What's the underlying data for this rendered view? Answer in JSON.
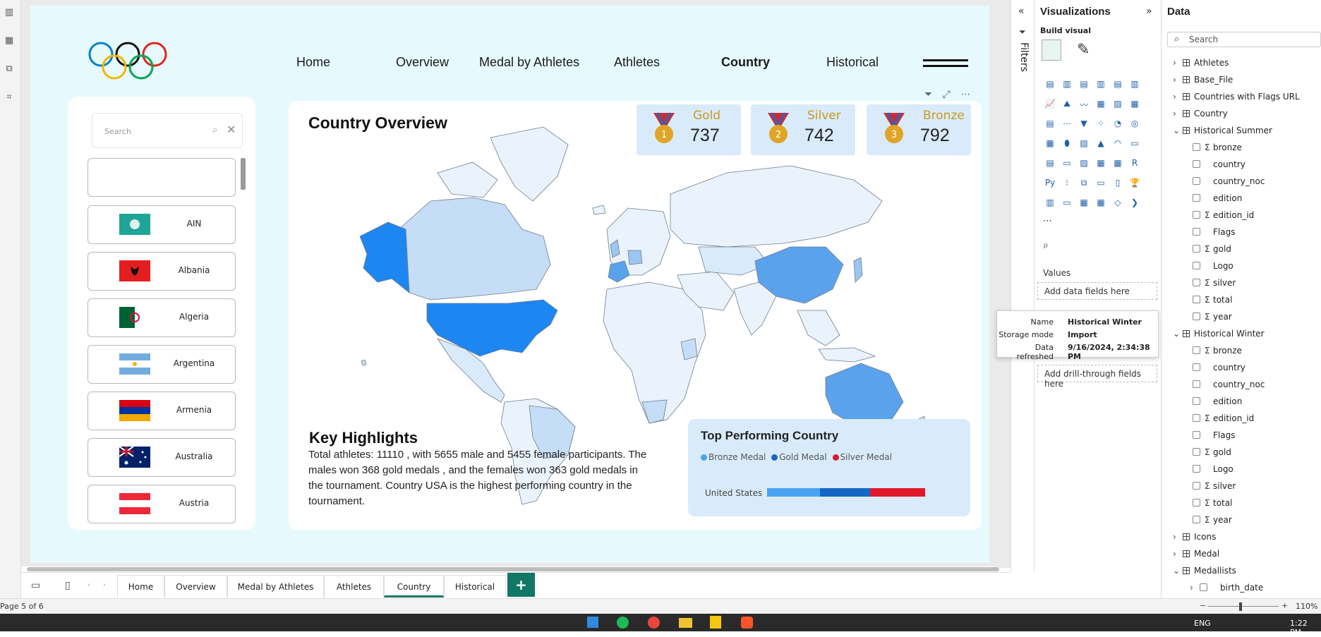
{
  "nav": {
    "items": [
      "Home",
      "Overview",
      "Medal by Athletes",
      "Athletes",
      "Country",
      "Historical"
    ],
    "active": "Country"
  },
  "slicer": {
    "search_placeholder": "Search",
    "countries": [
      "AIN",
      "Albania",
      "Algeria",
      "Argentina",
      "Armenia",
      "Australia",
      "Austria"
    ]
  },
  "overview": {
    "title": "Country Overview",
    "kpis": [
      {
        "label": "Gold",
        "value": "737",
        "medal_color": "#e0a526",
        "num": "1"
      },
      {
        "label": "Silver",
        "value": "742",
        "medal_color": "#e0a526",
        "num": "2"
      },
      {
        "label": "Bronze",
        "value": "792",
        "medal_color": "#e0a526",
        "num": "3"
      }
    ]
  },
  "highlights": {
    "title": "Key Highlights",
    "text": "Total athletes: 11110 , with 5655 male and 5455 female participants. The males won 368 gold medals , and the females won 363 gold medals in the tournament. Country USA is the highest performing country in the tournament."
  },
  "top_country": {
    "title": "Top Performing Country",
    "legend": [
      {
        "name": "Bronze Medal",
        "color": "#4aa3f0"
      },
      {
        "name": "Gold Medal",
        "color": "#1666c5"
      },
      {
        "name": "Silver Medal",
        "color": "#e0182b"
      }
    ],
    "category": "United States"
  },
  "chart_data": {
    "type": "bar",
    "orientation": "horizontal",
    "stacked": true,
    "title": "Top Performing Country",
    "categories": [
      "United States"
    ],
    "series": [
      {
        "name": "Bronze Medal",
        "values": [
          42
        ]
      },
      {
        "name": "Gold Medal",
        "values": [
          40
        ]
      },
      {
        "name": "Silver Medal",
        "values": [
          44
        ]
      }
    ]
  },
  "pages": {
    "tabs": [
      "Home",
      "Overview",
      "Medal by Athletes",
      "Athletes",
      "Country",
      "Historical"
    ],
    "active": "Country",
    "add_label": "+",
    "status": "Page 5 of 6",
    "zoom": "110%"
  },
  "filters_label": "Filters",
  "viz": {
    "title": "Visualizations",
    "build": "Build visual",
    "values_label": "Values",
    "add_fields": "Add data fields here",
    "add_drill": "Add drill-through fields here"
  },
  "tooltip": {
    "name_k": "Name",
    "name_v": "Historical Winter",
    "storage_k": "Storage mode",
    "storage_v": "Import",
    "refresh_k": "Data refreshed",
    "refresh_v": "9/16/2024, 2:34:38 PM"
  },
  "data": {
    "title": "Data",
    "search_placeholder": "Search",
    "tree": [
      {
        "kind": "table",
        "label": "Athletes",
        "open": false
      },
      {
        "kind": "table",
        "label": "Base_File",
        "open": false
      },
      {
        "kind": "table",
        "label": "Countries with Flags URL",
        "open": false
      },
      {
        "kind": "table",
        "label": "Country",
        "open": false
      },
      {
        "kind": "table",
        "label": "Historical Summer",
        "open": true
      },
      {
        "kind": "field",
        "label": "bronze",
        "sigma": true
      },
      {
        "kind": "field",
        "label": "country",
        "sigma": false
      },
      {
        "kind": "field",
        "label": "country_noc",
        "sigma": false
      },
      {
        "kind": "field",
        "label": "edition",
        "sigma": false
      },
      {
        "kind": "field",
        "label": "edition_id",
        "sigma": true
      },
      {
        "kind": "field",
        "label": "Flags",
        "sigma": false
      },
      {
        "kind": "field",
        "label": "gold",
        "sigma": true
      },
      {
        "kind": "field",
        "label": "Logo",
        "sigma": false
      },
      {
        "kind": "field",
        "label": "silver",
        "sigma": true
      },
      {
        "kind": "field",
        "label": "total",
        "sigma": true
      },
      {
        "kind": "field",
        "label": "year",
        "sigma": true
      },
      {
        "kind": "table",
        "label": "Historical Winter",
        "open": true
      },
      {
        "kind": "field",
        "label": "bronze",
        "sigma": true
      },
      {
        "kind": "field",
        "label": "country",
        "sigma": false
      },
      {
        "kind": "field",
        "label": "country_noc",
        "sigma": false
      },
      {
        "kind": "field",
        "label": "edition",
        "sigma": false
      },
      {
        "kind": "field",
        "label": "edition_id",
        "sigma": true
      },
      {
        "kind": "field",
        "label": "Flags",
        "sigma": false
      },
      {
        "kind": "field",
        "label": "gold",
        "sigma": true
      },
      {
        "kind": "field",
        "label": "Logo",
        "sigma": false
      },
      {
        "kind": "field",
        "label": "silver",
        "sigma": true
      },
      {
        "kind": "field",
        "label": "total",
        "sigma": true
      },
      {
        "kind": "field",
        "label": "year",
        "sigma": true
      },
      {
        "kind": "table",
        "label": "Icons",
        "open": false
      },
      {
        "kind": "table",
        "label": "Medal",
        "open": false
      },
      {
        "kind": "table",
        "label": "Medallists",
        "open": true
      },
      {
        "kind": "subfield",
        "label": "birth_date",
        "sigma": false
      }
    ]
  },
  "taskbar": {
    "lang": "ENG",
    "time": "1:22 PM"
  }
}
